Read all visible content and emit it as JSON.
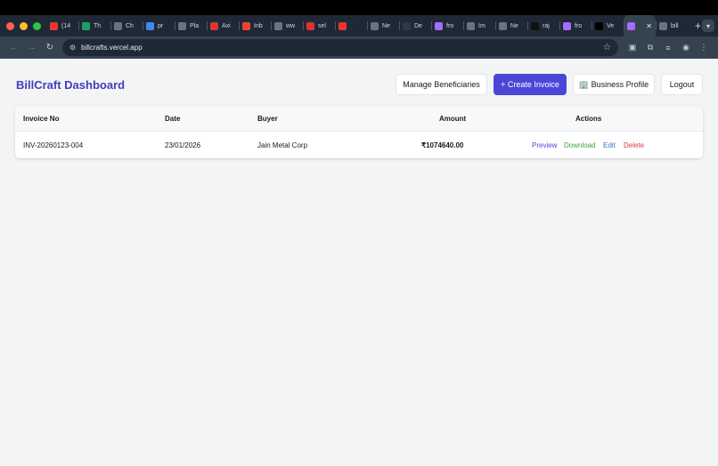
{
  "browser": {
    "traffic_lights": [
      "#ff5f57",
      "#febc2e",
      "#28c840"
    ],
    "tabs": [
      {
        "label": "(14",
        "icon": "youtube-icon",
        "color": "#e33"
      },
      {
        "label": "Th",
        "icon": "sheets-icon",
        "color": "#1aa260"
      },
      {
        "label": "Ch",
        "icon": "chatgpt-icon",
        "color": "#6b7280"
      },
      {
        "label": "pr",
        "icon": "google-icon",
        "color": "#4285f4"
      },
      {
        "label": "Pla",
        "icon": "globe-icon",
        "color": "#6b7280"
      },
      {
        "label": "Axi",
        "icon": "a-icon",
        "color": "#d33"
      },
      {
        "label": "Inb",
        "icon": "gmail-icon",
        "color": "#ea4335"
      },
      {
        "label": "ww",
        "icon": "globe-icon",
        "color": "#6b7280"
      },
      {
        "label": "sel",
        "icon": "a-icon",
        "color": "#d33"
      },
      {
        "label": "",
        "icon": "youtube-icon",
        "color": "#e33"
      },
      {
        "label": "Ne",
        "icon": "globe-icon",
        "color": "#6b7280"
      },
      {
        "label": "De",
        "icon": "d-icon",
        "color": "#2d3b48"
      },
      {
        "label": "fro",
        "icon": "vite-icon",
        "color": "#a66bff"
      },
      {
        "label": "Im",
        "icon": "chatgpt-icon",
        "color": "#6b7280"
      },
      {
        "label": "Ne",
        "icon": "chrome-icon",
        "color": "#6b7280"
      },
      {
        "label": "raj",
        "icon": "github-icon",
        "color": "#111"
      },
      {
        "label": "fro",
        "icon": "vite-icon",
        "color": "#a66bff"
      },
      {
        "label": "Ve",
        "icon": "vercel-icon",
        "color": "#000"
      },
      {
        "label": "",
        "icon": "vite-icon",
        "color": "#a66bff",
        "active": true
      },
      {
        "label": "bill",
        "icon": "globe-icon",
        "color": "#6b7280"
      }
    ],
    "url": "billcrafts.vercel.app"
  },
  "header": {
    "title": "BillCraft Dashboard",
    "buttons": {
      "manage": "Manage Beneficiaries",
      "create": "+ Create Invoice",
      "profile": "🏢 Business Profile",
      "logout": "Logout"
    }
  },
  "table": {
    "columns": [
      "Invoice No",
      "Date",
      "Buyer",
      "Amount",
      "Actions"
    ],
    "rows": [
      {
        "invoice_no": "INV-20260123-004",
        "date": "23/01/2026",
        "buyer": "Jain Metal Corp",
        "amount": "₹1074640.00",
        "actions": {
          "preview": "Preview",
          "download": "Download",
          "edit": "Edit",
          "delete": "Delete"
        }
      }
    ]
  },
  "colors": {
    "brand": "#3f3fb8",
    "primary_button": "#4a47d8",
    "preview": "#4a47d8",
    "download": "#3aa33a",
    "edit": "#3b6fd8",
    "delete": "#d93a3a"
  }
}
